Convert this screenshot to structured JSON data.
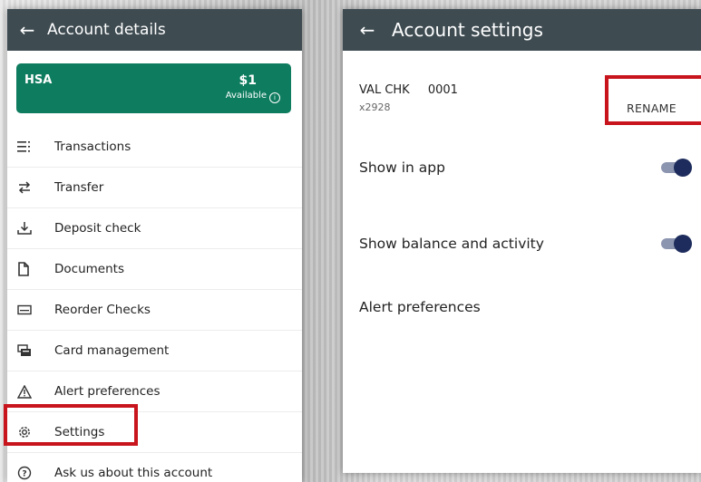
{
  "left_panel": {
    "header": {
      "title": "Account details"
    },
    "card": {
      "name": "HSA",
      "amount": "$1",
      "available_label": "Available"
    },
    "menu": [
      {
        "label": "Transactions",
        "icon": "list-icon"
      },
      {
        "label": "Transfer",
        "icon": "transfer-arrows-icon"
      },
      {
        "label": "Deposit check",
        "icon": "download-tray-icon"
      },
      {
        "label": "Documents",
        "icon": "document-icon"
      },
      {
        "label": "Reorder Checks",
        "icon": "check-card-icon"
      },
      {
        "label": "Card management",
        "icon": "cards-stack-icon"
      },
      {
        "label": "Alert preferences",
        "icon": "warning-triangle-icon"
      },
      {
        "label": "Settings",
        "icon": "gear-icon"
      },
      {
        "label": "Ask us about this account",
        "icon": "help-circle-icon"
      }
    ]
  },
  "right_panel": {
    "header": {
      "title": "Account settings"
    },
    "account": {
      "name": "VAL CHK",
      "number": "0001",
      "sub": "x2928"
    },
    "rename_label": "RENAME",
    "settings": [
      {
        "label": "Show in app",
        "toggle_on": true
      },
      {
        "label": "Show balance and activity",
        "toggle_on": true
      },
      {
        "label": "Alert preferences"
      }
    ]
  },
  "colors": {
    "appbar": "#3e4b51",
    "card": "#0e7c5f",
    "highlight": "#c8141c",
    "toggle_thumb": "#1d2c5c"
  }
}
